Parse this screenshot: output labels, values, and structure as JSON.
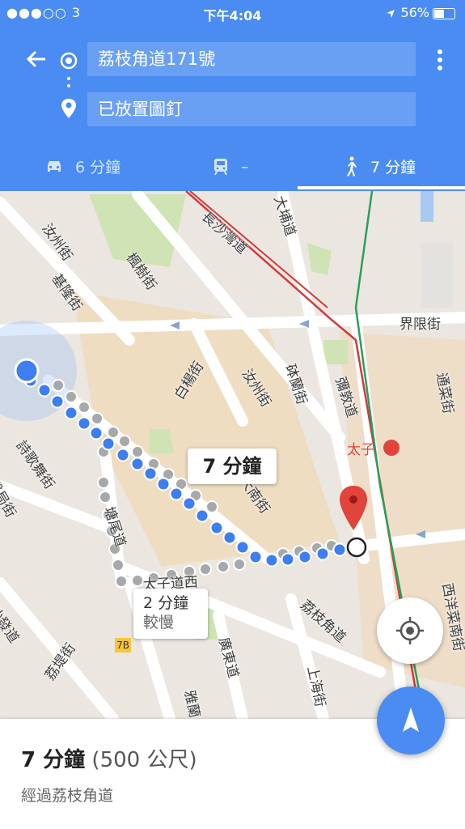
{
  "status_bar": {
    "carrier": "●●●○○ 3",
    "time": "下午4:04",
    "battery": "56%"
  },
  "directions": {
    "origin": "荔枝角道171號",
    "destination": "已放置圖釘"
  },
  "modes": [
    {
      "label": "6 分鐘"
    },
    {
      "label": "–"
    },
    {
      "label": "7 分鐘"
    }
  ],
  "map": {
    "streets": [
      "汝州街",
      "楓樹街",
      "基隆街",
      "長沙灣道",
      "大埔道",
      "界限街",
      "白楊街",
      "汝州街",
      "砵蘭街",
      "彌敦道",
      "通菜街",
      "詩歌舞街",
      "醫局街",
      "塘尾道",
      "大南街",
      "太子道西",
      "荔枝角道",
      "西洋菜南街",
      "沙發道",
      "廣東道",
      "上海街",
      "荔堤街",
      "雅蘭"
    ],
    "route_label": "7 分鐘",
    "alt_label": "2 分鐘",
    "alt_sublabel": "較慢",
    "mtr_station": "太子",
    "road_sign": "7B"
  },
  "summary": {
    "duration": "7 分鐘",
    "distance": "(500 公尺)",
    "via": "經過荔枝角道"
  },
  "colors": {
    "primary": "#4a8cf2",
    "route": "#3d7ef0",
    "pin": "#e0443b"
  }
}
